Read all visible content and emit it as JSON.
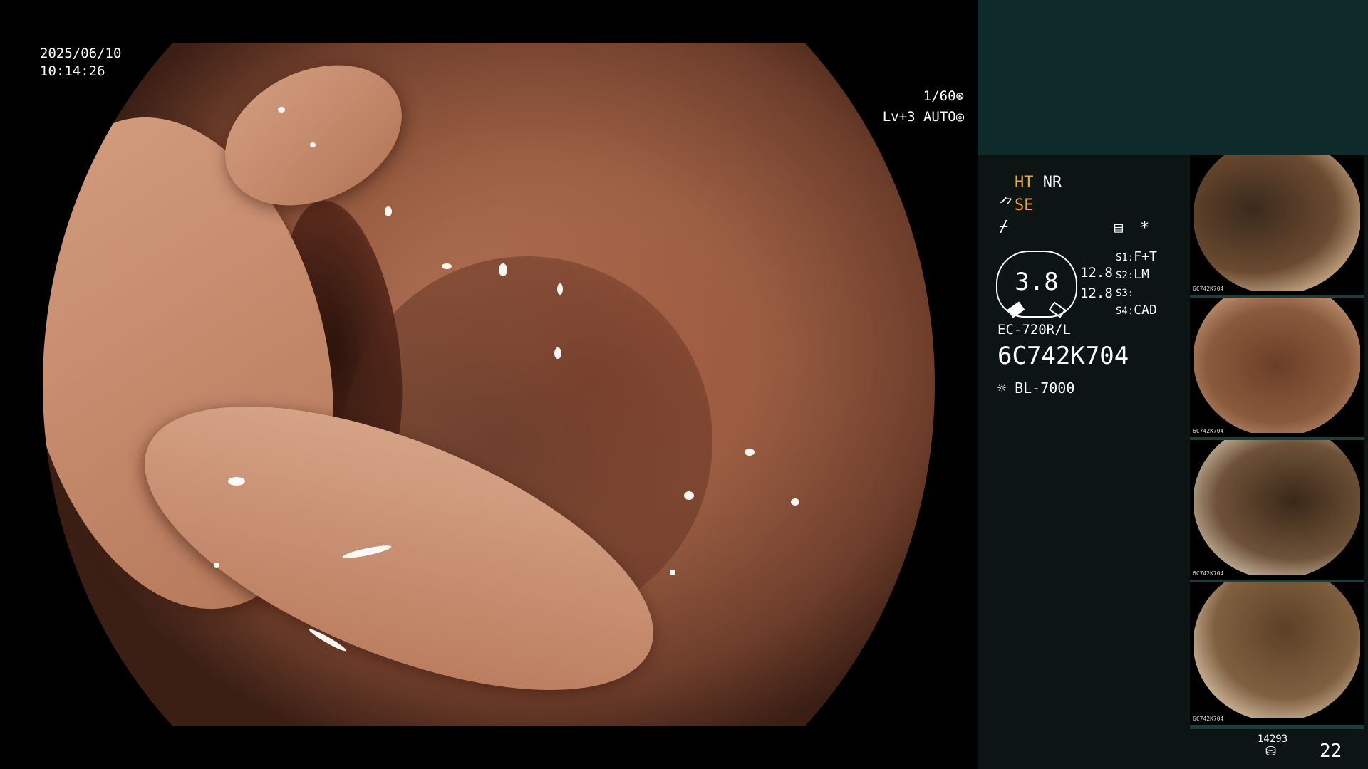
{
  "osd": {
    "date": "2025/06/10",
    "time": "10:14:26",
    "shutter": "1/60",
    "level": "Lv+3",
    "iris_mode": "AUTO"
  },
  "panel": {
    "ht": "HT",
    "nr": "NR",
    "se": "SE",
    "star": "*",
    "gauge_value": "3.8",
    "readout_1": "12.8",
    "readout_2": "12.8",
    "s1_label": "S1:",
    "s1_value": "F+T",
    "s2_label": "S2:",
    "s2_value": "LM",
    "s3_label": "S3:",
    "s3_value": "",
    "s4_label": "S4:",
    "s4_value": "CAD",
    "scope_model": "EC-720R/L",
    "scope_serial": "6C742K704",
    "light_source": "BL-7000",
    "counter": "14293",
    "image_count": "22"
  },
  "thumbnails": [
    {
      "label": "6C742K704"
    },
    {
      "label": "6C742K704"
    },
    {
      "label": "6C742K704"
    },
    {
      "label": "6C742K704"
    }
  ],
  "colors": {
    "accent": "#f2a72a",
    "panel_top": "#0f2a2a",
    "panel_bg": "#0d1414",
    "mucosa": "#b87a5c"
  },
  "icons": [
    "shutter-icon",
    "iris-icon",
    "structure-enhance-icon",
    "settings-icon",
    "light-source-icon",
    "storage-icon"
  ]
}
